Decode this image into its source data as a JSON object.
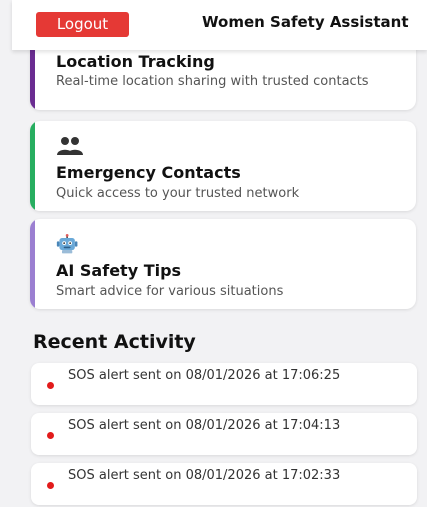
{
  "header": {
    "logout_label": "Logout",
    "title": "Women Safety Assistant"
  },
  "features": [
    {
      "title": "Location Tracking",
      "description": "Real-time location sharing with trusted contacts",
      "accent_color": "#6a2c91",
      "icon": "location-icon"
    },
    {
      "title": "Emergency Contacts",
      "description": "Quick access to your trusted network",
      "accent_color": "#27ae60",
      "icon": "people-icon"
    },
    {
      "title": "AI Safety Tips",
      "description": "Smart advice for various situations",
      "accent_color": "#9b7fd1",
      "icon": "robot-icon"
    }
  ],
  "recent_activity": {
    "heading": "Recent Activity",
    "items": [
      {
        "text": "SOS alert sent on 08/01/2026 at 17:06:25"
      },
      {
        "text": "SOS alert sent on 08/01/2026 at 17:04:13"
      },
      {
        "text": "SOS alert sent on 08/01/2026 at 17:02:33"
      }
    ]
  },
  "colors": {
    "logout": "#e53935",
    "alert_dot": "#e21b1b",
    "background": "#f2f2f4"
  }
}
